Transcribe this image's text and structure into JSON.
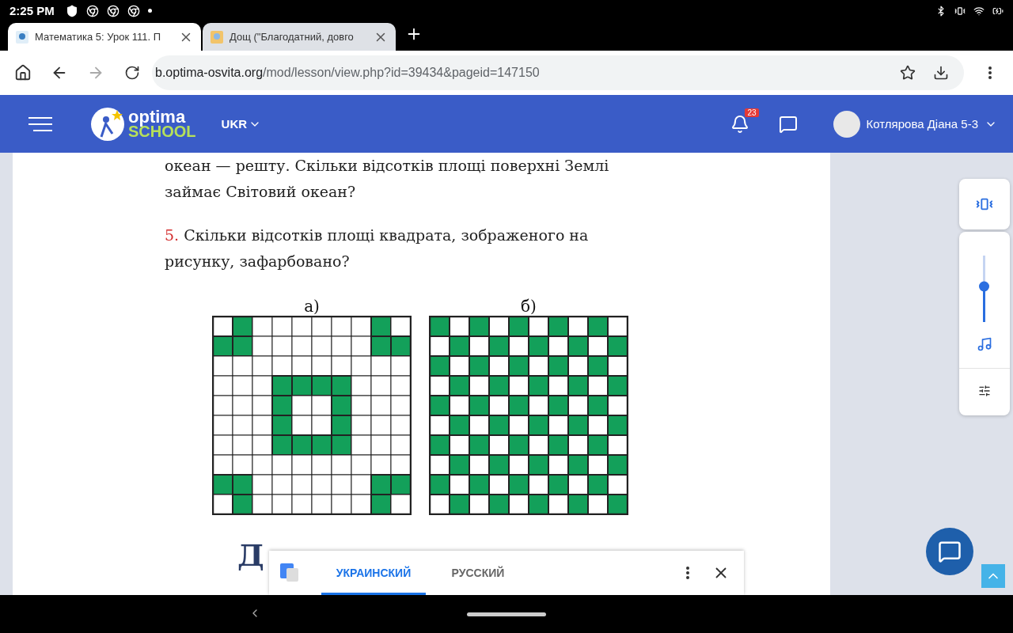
{
  "status_bar": {
    "time": "2:25 PM"
  },
  "browser": {
    "tabs": [
      {
        "title": "Математика 5: Урок 111. П",
        "selected": true
      },
      {
        "title": "Дощ (\"Благодатний, довго",
        "selected": false
      }
    ],
    "url_host": "b.optima-osvita.org",
    "url_path": "/mod/lesson/view.php?id=39434&pageid=147150"
  },
  "site_header": {
    "logo_top": "optima",
    "logo_bottom": "SCHOOL",
    "language": "UKR",
    "notification_count": "23",
    "user_name": "Котлярова Діана 5-3"
  },
  "lesson": {
    "paragraphs": [
      {
        "text": "океан — решту. Скільки відсотків площі поверхні Землі займає Світовий океан?"
      },
      {
        "number": "5.",
        "text": "Скільки відсотків площі квадрата, зображеного на рисунку, зафарбовано?"
      }
    ],
    "figures": [
      {
        "label": "а)",
        "kind": "corners_ring"
      },
      {
        "label": "б)",
        "kind": "checker"
      }
    ],
    "heading_fragment": "Д"
  },
  "volume_panel": {
    "level": 0.54
  },
  "translate_bar": {
    "tabs": [
      {
        "label": "УКРАИНСКИЙ",
        "selected": true
      },
      {
        "label": "РУССКИЙ",
        "selected": false
      }
    ]
  }
}
